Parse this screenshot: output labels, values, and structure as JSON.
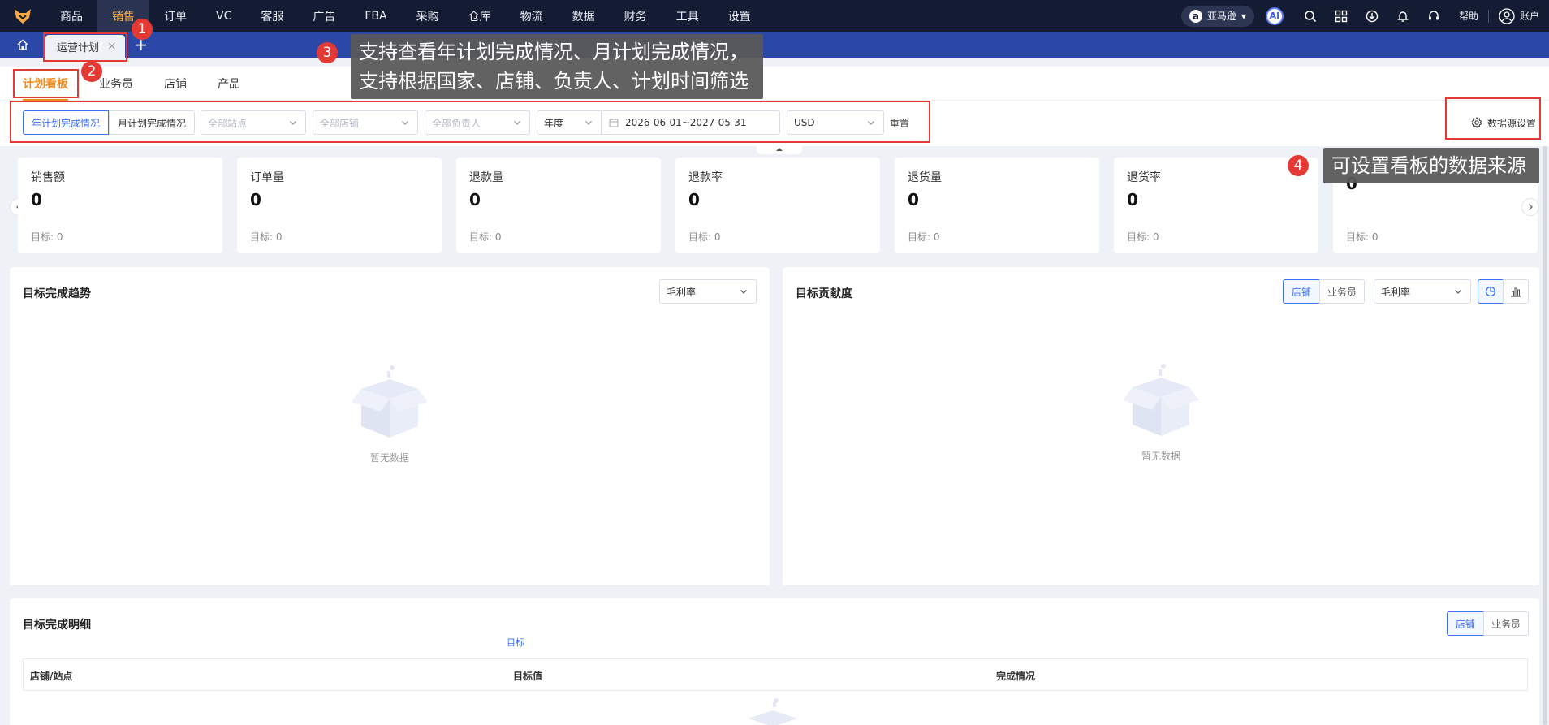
{
  "topnav": {
    "items": [
      "商品",
      "销售",
      "订单",
      "VC",
      "客服",
      "广告",
      "FBA",
      "采购",
      "仓库",
      "物流",
      "数据",
      "财务",
      "工具",
      "设置"
    ],
    "active": "销售",
    "platform": "亚马逊",
    "ai_label": "AI",
    "help": "帮助",
    "account": "账户"
  },
  "tabbar": {
    "tab_label": "运营计划",
    "close": "×",
    "add": "+"
  },
  "subtabs": [
    "计划看板",
    "业务员",
    "店铺",
    "产品"
  ],
  "filters": {
    "year_plan": "年计划完成情况",
    "month_plan": "月计划完成情况",
    "site_placeholder": "全部站点",
    "shop_placeholder": "全部店铺",
    "owner_placeholder": "全部负责人",
    "period": "年度",
    "date_range": "2026-06-01~2027-05-31",
    "currency": "USD",
    "reset": "重置",
    "data_source": "数据源设置"
  },
  "kpis": [
    {
      "label": "销售额",
      "value": "0",
      "target": "目标: 0"
    },
    {
      "label": "订单量",
      "value": "0",
      "target": "目标: 0"
    },
    {
      "label": "退款量",
      "value": "0",
      "target": "目标: 0"
    },
    {
      "label": "退款率",
      "value": "0",
      "target": "目标: 0"
    },
    {
      "label": "退货量",
      "value": "0",
      "target": "目标: 0"
    },
    {
      "label": "退货率",
      "value": "0",
      "target": "目标: 0"
    },
    {
      "label": "",
      "value": "0",
      "target": "目标: 0"
    }
  ],
  "trend_panel": {
    "title": "目标完成趋势",
    "metric": "毛利率",
    "empty": "暂无数据"
  },
  "contrib_panel": {
    "title": "目标贡献度",
    "seg_shop": "店铺",
    "seg_staff": "业务员",
    "metric": "毛利率",
    "empty": "暂无数据"
  },
  "detail_panel": {
    "title": "目标完成明细",
    "seg_shop": "店铺",
    "seg_staff": "业务员",
    "group_label": "目标",
    "columns": [
      "店铺/站点",
      "目标值",
      "完成情况"
    ]
  },
  "annotations": {
    "n1": "1",
    "n2": "2",
    "n3": "3",
    "n4": "4",
    "tip3_line1": "支持查看年计划完成情况、月计划完成情况，",
    "tip3_line2": "支持根据国家、店铺、负责人、计划时间筛选",
    "tip4": "可设置看板的数据来源"
  },
  "colors": {
    "nav_bg": "#141c33",
    "tab_bar": "#2b47a8",
    "accent_orange": "#f08c1d",
    "primary_blue": "#3a6ff7",
    "annotation_red": "#e53935"
  }
}
